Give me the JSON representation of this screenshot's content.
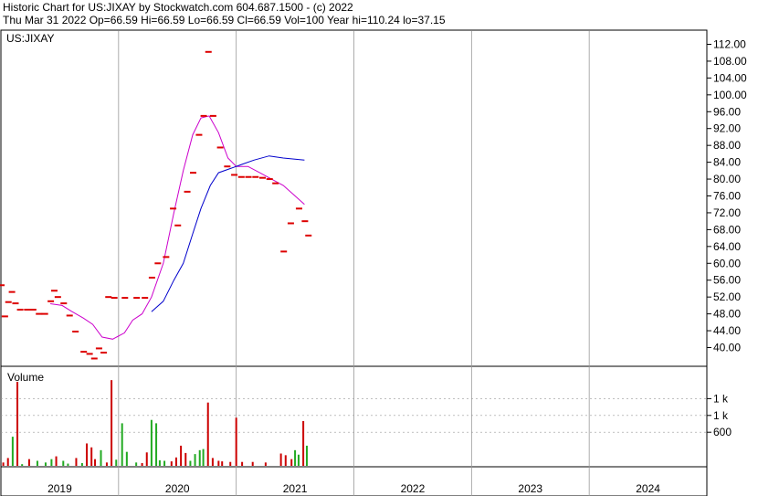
{
  "header": {
    "line1": "Historic Chart for US:JIXAY by Stockwatch.com 604.687.1500 - (c) 2022",
    "line2": "Thu Mar 31 2022   Op=66.59   Hi=66.59   Lo=66.59   Cl=66.59   Vol=100   Year hi=110.24   lo=37.15"
  },
  "colors": {
    "price": "#dd0000",
    "ma_short": "#cc00cc",
    "ma_long": "#0000cc",
    "vol_up": "#22aa22",
    "vol_down": "#cc0000",
    "grid": "#999999"
  },
  "chart_data": [
    {
      "type": "line",
      "title": "US:JIXAY",
      "y_ticks": [
        "112.00",
        "108.00",
        "104.00",
        "100.00",
        "96.00",
        "92.00",
        "88.00",
        "84.00",
        "80.00",
        "76.00",
        "72.00",
        "68.00",
        "64.00",
        "60.00",
        "56.00",
        "52.00",
        "48.00",
        "44.00",
        "40.00"
      ],
      "ylim": [
        36.4,
        115.0
      ],
      "grid": true,
      "series": [
        {
          "role": "price",
          "points": [
            [
              2019.0,
              54.8
            ],
            [
              2019.03,
              47.4
            ],
            [
              2019.06,
              50.8
            ],
            [
              2019.09,
              53.2
            ],
            [
              2019.12,
              50.5
            ],
            [
              2019.16,
              49.0
            ],
            [
              2019.22,
              49.0
            ],
            [
              2019.27,
              49.0
            ],
            [
              2019.32,
              48.0
            ],
            [
              2019.37,
              48.0
            ],
            [
              2019.42,
              51.0
            ],
            [
              2019.45,
              53.5
            ],
            [
              2019.48,
              52.0
            ],
            [
              2019.53,
              50.5
            ],
            [
              2019.58,
              47.6
            ],
            [
              2019.63,
              43.8
            ],
            [
              2019.7,
              39.0
            ],
            [
              2019.75,
              38.5
            ],
            [
              2019.79,
              37.4
            ],
            [
              2019.83,
              39.8
            ],
            [
              2019.87,
              38.8
            ],
            [
              2019.91,
              52.0
            ],
            [
              2019.96,
              51.8
            ],
            [
              2020.05,
              51.8
            ],
            [
              2020.15,
              51.8
            ],
            [
              2020.22,
              51.8
            ],
            [
              2020.28,
              56.6
            ],
            [
              2020.33,
              60.0
            ],
            [
              2020.4,
              61.5
            ],
            [
              2020.46,
              73.0
            ],
            [
              2020.5,
              69.0
            ],
            [
              2020.58,
              77.0
            ],
            [
              2020.63,
              81.5
            ],
            [
              2020.68,
              90.5
            ],
            [
              2020.72,
              95.0
            ],
            [
              2020.76,
              110.2
            ],
            [
              2020.8,
              95.0
            ],
            [
              2020.86,
              87.5
            ],
            [
              2020.92,
              83.0
            ],
            [
              2020.98,
              81.0
            ],
            [
              2021.04,
              80.5
            ],
            [
              2021.1,
              80.5
            ],
            [
              2021.16,
              80.5
            ],
            [
              2021.22,
              80.3
            ],
            [
              2021.28,
              80.0
            ],
            [
              2021.33,
              79.0
            ],
            [
              2021.4,
              62.8
            ],
            [
              2021.46,
              69.5
            ],
            [
              2021.53,
              73.0
            ],
            [
              2021.58,
              70.0
            ],
            [
              2021.61,
              66.6
            ]
          ]
        },
        {
          "role": "ma_short",
          "points": [
            [
              2019.42,
              50.4
            ],
            [
              2019.52,
              50.0
            ],
            [
              2019.6,
              48.6
            ],
            [
              2019.7,
              47.0
            ],
            [
              2019.78,
              45.5
            ],
            [
              2019.86,
              42.5
            ],
            [
              2019.95,
              42.0
            ],
            [
              2020.05,
              43.5
            ],
            [
              2020.12,
              46.5
            ],
            [
              2020.2,
              48.0
            ],
            [
              2020.28,
              52.0
            ],
            [
              2020.38,
              60.0
            ],
            [
              2020.47,
              72.0
            ],
            [
              2020.55,
              82.0
            ],
            [
              2020.63,
              90.5
            ],
            [
              2020.7,
              94.5
            ],
            [
              2020.77,
              95.0
            ],
            [
              2020.85,
              91.0
            ],
            [
              2020.93,
              85.0
            ],
            [
              2021.0,
              83.0
            ],
            [
              2021.1,
              83.0
            ],
            [
              2021.2,
              81.5
            ],
            [
              2021.3,
              80.0
            ],
            [
              2021.4,
              78.5
            ],
            [
              2021.5,
              76.0
            ],
            [
              2021.58,
              74.0
            ]
          ]
        },
        {
          "role": "ma_long",
          "points": [
            [
              2020.28,
              48.5
            ],
            [
              2020.38,
              51.0
            ],
            [
              2020.47,
              56.0
            ],
            [
              2020.55,
              60.0
            ],
            [
              2020.63,
              67.0
            ],
            [
              2020.7,
              73.0
            ],
            [
              2020.78,
              78.5
            ],
            [
              2020.85,
              81.5
            ],
            [
              2020.95,
              82.5
            ],
            [
              2021.05,
              83.5
            ],
            [
              2021.15,
              84.5
            ],
            [
              2021.28,
              85.5
            ],
            [
              2021.4,
              85.0
            ],
            [
              2021.58,
              84.5
            ]
          ]
        }
      ]
    },
    {
      "type": "bar",
      "title": "Volume",
      "y_ticks": [
        "1 k",
        "1 k",
        "600"
      ],
      "x_ticks": [
        "2019",
        "2020",
        "2021",
        "2022",
        "2023",
        "2024"
      ],
      "ylim": [
        0,
        1500
      ],
      "grid": true,
      "bars": [
        {
          "x": 2019.02,
          "v": 60,
          "c": "down"
        },
        {
          "x": 2019.06,
          "v": 140,
          "c": "down"
        },
        {
          "x": 2019.1,
          "v": 520,
          "c": "up"
        },
        {
          "x": 2019.14,
          "v": 1500,
          "c": "down"
        },
        {
          "x": 2019.18,
          "v": 30,
          "c": "up"
        },
        {
          "x": 2019.24,
          "v": 120,
          "c": "down"
        },
        {
          "x": 2019.31,
          "v": 90,
          "c": "up"
        },
        {
          "x": 2019.38,
          "v": 60,
          "c": "up"
        },
        {
          "x": 2019.43,
          "v": 120,
          "c": "up"
        },
        {
          "x": 2019.47,
          "v": 170,
          "c": "down"
        },
        {
          "x": 2019.53,
          "v": 90,
          "c": "up"
        },
        {
          "x": 2019.57,
          "v": 40,
          "c": "up"
        },
        {
          "x": 2019.64,
          "v": 140,
          "c": "down"
        },
        {
          "x": 2019.69,
          "v": 50,
          "c": "up"
        },
        {
          "x": 2019.73,
          "v": 400,
          "c": "down"
        },
        {
          "x": 2019.77,
          "v": 330,
          "c": "down"
        },
        {
          "x": 2019.8,
          "v": 120,
          "c": "down"
        },
        {
          "x": 2019.85,
          "v": 280,
          "c": "up"
        },
        {
          "x": 2019.9,
          "v": 60,
          "c": "down"
        },
        {
          "x": 2019.94,
          "v": 1530,
          "c": "down"
        },
        {
          "x": 2019.98,
          "v": 110,
          "c": "up"
        },
        {
          "x": 2020.03,
          "v": 760,
          "c": "up"
        },
        {
          "x": 2020.07,
          "v": 250,
          "c": "up"
        },
        {
          "x": 2020.15,
          "v": 60,
          "c": "up"
        },
        {
          "x": 2020.2,
          "v": 50,
          "c": "down"
        },
        {
          "x": 2020.24,
          "v": 240,
          "c": "down"
        },
        {
          "x": 2020.28,
          "v": 820,
          "c": "up"
        },
        {
          "x": 2020.32,
          "v": 760,
          "c": "up"
        },
        {
          "x": 2020.35,
          "v": 100,
          "c": "up"
        },
        {
          "x": 2020.39,
          "v": 90,
          "c": "up"
        },
        {
          "x": 2020.45,
          "v": 80,
          "c": "down"
        },
        {
          "x": 2020.49,
          "v": 150,
          "c": "down"
        },
        {
          "x": 2020.53,
          "v": 360,
          "c": "down"
        },
        {
          "x": 2020.57,
          "v": 230,
          "c": "down"
        },
        {
          "x": 2020.61,
          "v": 90,
          "c": "up"
        },
        {
          "x": 2020.65,
          "v": 210,
          "c": "up"
        },
        {
          "x": 2020.69,
          "v": 280,
          "c": "up"
        },
        {
          "x": 2020.72,
          "v": 300,
          "c": "up"
        },
        {
          "x": 2020.76,
          "v": 1130,
          "c": "down"
        },
        {
          "x": 2020.8,
          "v": 140,
          "c": "down"
        },
        {
          "x": 2020.85,
          "v": 90,
          "c": "down"
        },
        {
          "x": 2020.88,
          "v": 80,
          "c": "down"
        },
        {
          "x": 2020.95,
          "v": 70,
          "c": "down"
        },
        {
          "x": 2021.0,
          "v": 860,
          "c": "down"
        },
        {
          "x": 2021.05,
          "v": 70,
          "c": "down"
        },
        {
          "x": 2021.14,
          "v": 70,
          "c": "down"
        },
        {
          "x": 2021.25,
          "v": 60,
          "c": "down"
        },
        {
          "x": 2021.38,
          "v": 220,
          "c": "down"
        },
        {
          "x": 2021.42,
          "v": 190,
          "c": "down"
        },
        {
          "x": 2021.47,
          "v": 120,
          "c": "down"
        },
        {
          "x": 2021.5,
          "v": 280,
          "c": "up"
        },
        {
          "x": 2021.53,
          "v": 200,
          "c": "up"
        },
        {
          "x": 2021.57,
          "v": 800,
          "c": "down"
        },
        {
          "x": 2021.6,
          "v": 360,
          "c": "up"
        }
      ]
    }
  ]
}
